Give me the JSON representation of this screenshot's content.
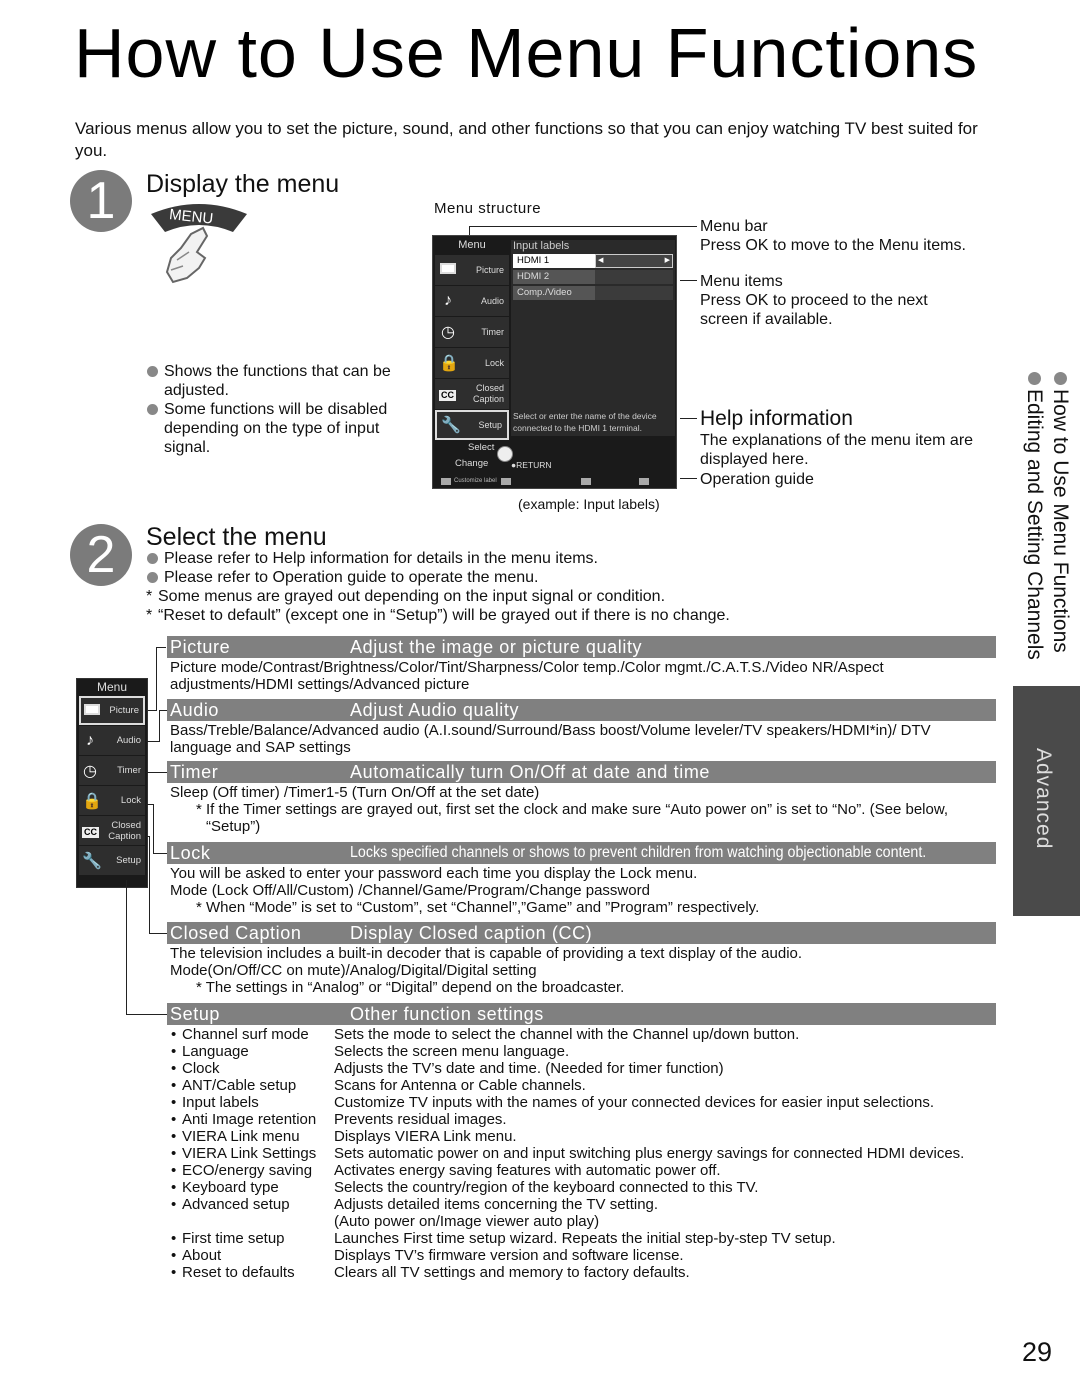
{
  "page": {
    "title": "How to Use Menu Functions",
    "intro": "Various menus allow you to set the picture, sound, and other functions so that you can enjoy watching TV best suited for you.",
    "page_number": "29"
  },
  "step1": {
    "number": "1",
    "title": "Display the menu",
    "button_label": "MENU",
    "bullets": [
      "Shows the functions that can be adjusted.",
      "Some functions will be disabled depending on the type of input signal."
    ],
    "menu_structure_label": "Menu structure",
    "example_caption": "(example: Input labels)"
  },
  "tv_menu": {
    "side_title": "Menu",
    "items": [
      {
        "label": "Picture",
        "icon": "picture-icon"
      },
      {
        "label": "Audio",
        "icon": "music-note-icon"
      },
      {
        "label": "Timer",
        "icon": "timer-icon"
      },
      {
        "label": "Lock",
        "icon": "lock-icon"
      },
      {
        "label": "Closed Caption",
        "icon": "cc-icon"
      },
      {
        "label": "Setup",
        "icon": "wrench-icon"
      }
    ],
    "main_title": "Input labels",
    "rows": [
      "HDMI 1",
      "HDMI 2",
      "Comp./Video"
    ],
    "help_text": "Select or enter the name of the device connected to the HDMI 1 terminal.",
    "guide": {
      "select": "Select",
      "change": "Change",
      "return": "RETURN",
      "customize": "Customize label"
    }
  },
  "annotations": {
    "menu_bar": {
      "head": "Menu bar",
      "text": "Press OK to move to the Menu items."
    },
    "menu_items": {
      "head": "Menu items",
      "text": "Press OK to proceed to the next screen if available."
    },
    "help_info": {
      "head": "Help information",
      "text": "The explanations of the menu item are displayed here."
    },
    "operation_guide": {
      "head": "Operation guide"
    }
  },
  "side_nav": {
    "items": [
      "How to Use Menu Functions",
      "Editing and Setting Channels"
    ],
    "tab_label": "Advanced"
  },
  "step2": {
    "number": "2",
    "title": "Select the menu",
    "bullets": [
      "Please refer to Help information for details in the menu items.",
      "Please refer to Operation guide to operate the menu."
    ],
    "notes": [
      "Some menus are grayed out depending on the input signal or condition.",
      "“Reset to default” (except one in “Setup”) will be grayed out if there is no change."
    ]
  },
  "mini_menu": {
    "title": "Menu",
    "items": [
      "Picture",
      "Audio",
      "Timer",
      "Lock",
      "Closed Caption",
      "Setup"
    ],
    "cc_badge": "CC"
  },
  "sections": {
    "picture": {
      "name": "Picture",
      "desc": "Adjust the image or picture quality",
      "body": "Picture mode/Contrast/Brightness/Color/Tint/Sharpness/Color temp./Color mgmt./C.A.T.S./Video NR/Aspect adjustments/HDMI settings/Advanced picture"
    },
    "audio": {
      "name": "Audio",
      "desc": "Adjust Audio quality",
      "body": "Bass/Treble/Balance/Advanced audio (A.I.sound/Surround/Bass boost/Volume leveler/TV speakers/HDMI*in)/ DTV language and SAP settings"
    },
    "timer": {
      "name": "Timer",
      "desc": "Automatically turn On/Off at date and time",
      "body": "Sleep (Off timer) /Timer1-5 (Turn On/Off at the set date)",
      "note": "* If the Timer settings are grayed out, first set the clock and make sure “Auto power on” is set to “No”. (See below, “Setup”)"
    },
    "lock": {
      "name": "Lock",
      "desc": "Locks specified channels or shows to prevent children from watching objectionable content.",
      "body1": "You will be asked to enter your password each time you display the Lock menu.",
      "body2": "Mode (Lock Off/All/Custom) /Channel/Game/Program/Change password",
      "note": "* When “Mode” is set to “Custom”, set “Channel”,”Game” and ”Program” respectively."
    },
    "closed_caption": {
      "name": "Closed Caption",
      "desc": "Display Closed caption (CC)",
      "body1": "The television includes a built-in decoder that is capable of providing a text display of the audio.",
      "body2": "Mode(On/Off/CC on mute)/Analog/Digital/Digital setting",
      "note": "* The settings in “Analog” or “Digital” depend on the broadcaster."
    },
    "setup": {
      "name": "Setup",
      "desc": "Other function settings",
      "items": [
        {
          "item": "Channel surf mode",
          "desc": "Sets the mode to select the channel with the Channel up/down button."
        },
        {
          "item": "Language",
          "desc": "Selects the screen menu language."
        },
        {
          "item": "Clock",
          "desc": "Adjusts the TV’s date and time. (Needed for timer function)"
        },
        {
          "item": "ANT/Cable setup",
          "desc": "Scans for Antenna or Cable channels."
        },
        {
          "item": "Input labels",
          "desc": "Customize TV inputs with the names of your connected devices for easier input selections."
        },
        {
          "item": "Anti Image retention",
          "desc": "Prevents residual images."
        },
        {
          "item": "VIERA Link menu",
          "desc": "Displays VIERA Link menu."
        },
        {
          "item": "VIERA Link Settings",
          "desc": "Sets automatic power on and input switching plus energy savings for connected HDMI devices."
        },
        {
          "item": "ECO/energy saving",
          "desc": "Activates energy saving features with automatic power off."
        },
        {
          "item": "Keyboard type",
          "desc": "Selects the country/region of the keyboard connected to this TV."
        },
        {
          "item": "Advanced setup",
          "desc": "Adjusts detailed items concerning the TV setting."
        },
        {
          "item": "",
          "desc": "(Auto power on/Image viewer auto play)"
        },
        {
          "item": "First time setup",
          "desc": "Launches First time setup wizard. Repeats the initial step-by-step TV setup."
        },
        {
          "item": "About",
          "desc": "Displays TV’s firmware version and software license."
        },
        {
          "item": "Reset to defaults",
          "desc": "Clears all TV settings and memory to factory defaults."
        }
      ]
    }
  }
}
